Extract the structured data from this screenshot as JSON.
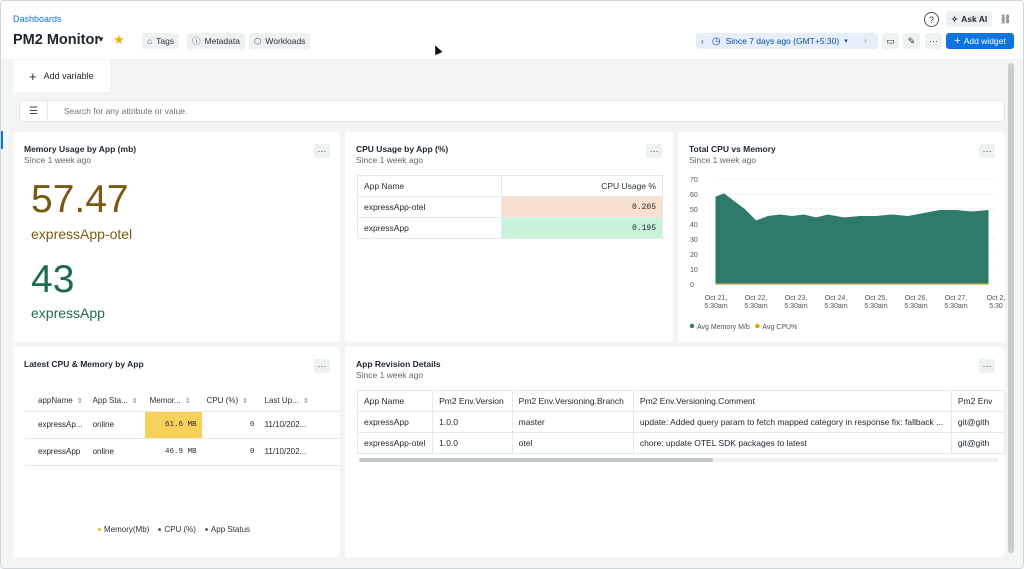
{
  "header": {
    "breadcrumb": "Dashboards",
    "title": "PM2 Monitor",
    "chips": [
      {
        "label": "Tags",
        "icon": "tag-icon"
      },
      {
        "label": "Metadata",
        "icon": "info-icon"
      },
      {
        "label": "Workloads",
        "icon": "workloads-icon"
      }
    ],
    "ask_ai": "Ask AI",
    "time_range": "Since 7 days ago (GMT+5:30)",
    "add_widget": "Add widget"
  },
  "variables": {
    "add_variable": "Add variable"
  },
  "filter": {
    "placeholder": "Search for any attribute or value."
  },
  "widgets": {
    "memory": {
      "title": "Memory Usage by App (mb)",
      "subtitle": "Since 1 week ago",
      "items": [
        {
          "value": "57.47",
          "label": "expressApp-otel",
          "color": "#7a5a12"
        },
        {
          "value": "43",
          "label": "expressApp",
          "color": "#1e6b4f"
        }
      ]
    },
    "cpu": {
      "title": "CPU Usage by App (%)",
      "subtitle": "Since 1 week ago",
      "columns": [
        "App Name",
        "CPU Usage %"
      ],
      "rows": [
        {
          "app": "expressApp-otel",
          "value": "0.205",
          "color": "#f9dfd0"
        },
        {
          "app": "expressApp",
          "value": "0.195",
          "color": "#c7f3da"
        }
      ]
    },
    "total": {
      "title": "Total CPU vs Memory",
      "subtitle": "Since 1 week ago"
    },
    "latest": {
      "title": "Latest CPU & Memory by App",
      "columns": [
        "appName",
        "App Sta...",
        "Memor...",
        "CPU (%)",
        "Last Up..."
      ],
      "rows": [
        {
          "app": "expressAp...",
          "status": "online",
          "memory": "61.6 MB",
          "cpu": "0",
          "updated": "11/10/202...",
          "highlight": "#f7d15a"
        },
        {
          "app": "expressApp",
          "status": "online",
          "memory": "46.9 MB",
          "cpu": "0",
          "updated": "11/10/202...",
          "highlight": ""
        }
      ],
      "legend": [
        {
          "label": "Memory(Mb)",
          "color": "#f0b400"
        },
        {
          "label": "CPU (%)",
          "color": "#5e686c"
        },
        {
          "label": "App Status",
          "color": "#5e686c"
        }
      ]
    },
    "revision": {
      "title": "App Revision Details",
      "subtitle": "Since 1 week ago",
      "columns": [
        "App Name",
        "Pm2 Env.Version",
        "Pm2 Env.Versioning.Branch",
        "Pm2 Env.Versioning.Comment",
        "Pm2 Env"
      ],
      "rows": [
        [
          "expressApp",
          "1.0.0",
          "master",
          "update: Added query param to fetch mapped category in response fix: fallback ...",
          "git@gith"
        ],
        [
          "expressApp-otel",
          "1.0.0",
          "otel",
          "chore: update OTEL SDK packages to latest",
          "git@gith"
        ]
      ]
    }
  },
  "chart_data": {
    "type": "area",
    "title": "Total CPU vs Memory",
    "x": [
      "Oct 21, 5:30am",
      "Oct 22, 5:30am",
      "Oct 23, 5:30am",
      "Oct 24, 5:30am",
      "Oct 25, 5:30am",
      "Oct 26, 5:30am",
      "Oct 27, 5:30am",
      "Oct 2 5:30"
    ],
    "ylim": [
      0,
      70
    ],
    "yticks": [
      0,
      10,
      20,
      30,
      40,
      50,
      60,
      70
    ],
    "series": [
      {
        "name": "Avg Memory M/b",
        "color": "#2e7b6b",
        "x": [
          0,
          0.2,
          0.4,
          0.7,
          1.0,
          1.3,
          1.6,
          1.9,
          2.2,
          2.5,
          2.8,
          3.2,
          3.6,
          4.0,
          4.4,
          4.8,
          5.2,
          5.6,
          6.0,
          6.4,
          6.8
        ],
        "values": [
          58,
          60,
          56,
          50,
          42,
          45,
          46,
          45,
          46,
          44,
          46,
          44,
          45,
          45,
          46,
          45,
          47,
          49,
          49,
          48,
          49
        ]
      },
      {
        "name": "Avg CPU%",
        "color": "#d9a400",
        "x": [
          0,
          6.8
        ],
        "values": [
          0.2,
          0.2
        ]
      }
    ],
    "grid": true,
    "legend": "bottom-left"
  }
}
